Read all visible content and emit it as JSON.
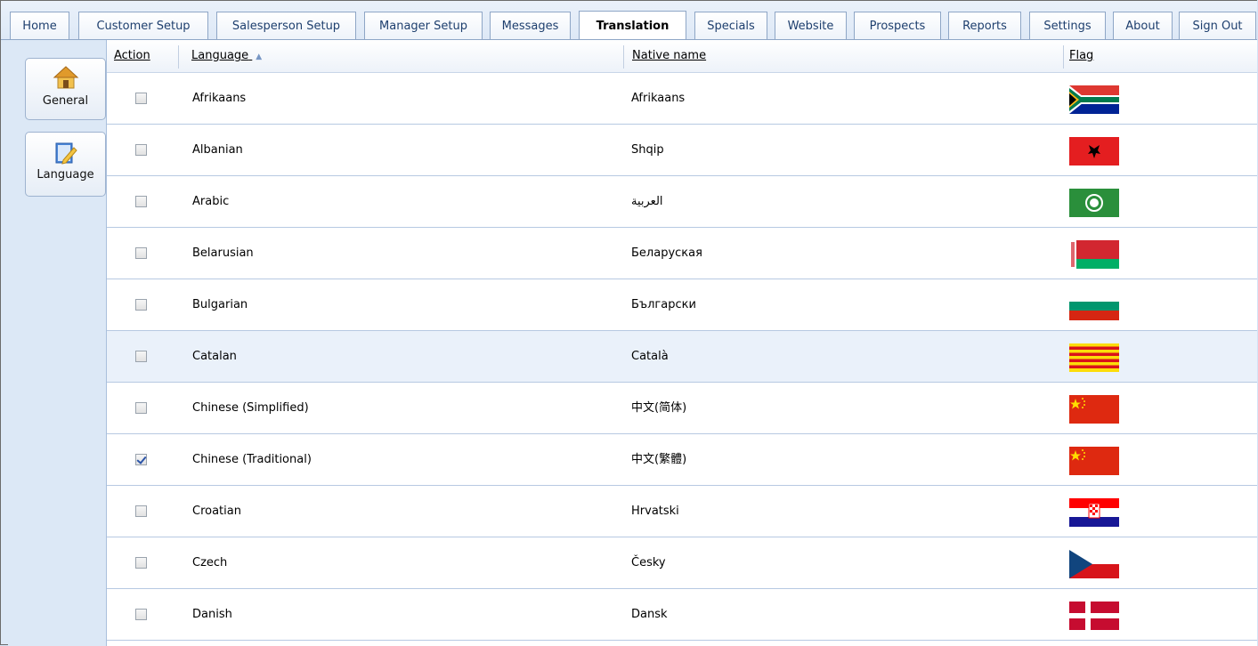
{
  "tabs": [
    {
      "label": "Home",
      "active": false
    },
    {
      "label": "Customer Setup",
      "active": false
    },
    {
      "label": "Salesperson Setup",
      "active": false
    },
    {
      "label": "Manager Setup",
      "active": false
    },
    {
      "label": "Messages",
      "active": false
    },
    {
      "label": "Translation",
      "active": true
    },
    {
      "label": "Specials",
      "active": false
    },
    {
      "label": "Website",
      "active": false
    },
    {
      "label": "Prospects",
      "active": false
    },
    {
      "label": "Reports",
      "active": false
    },
    {
      "label": "Settings",
      "active": false
    },
    {
      "label": "About",
      "active": false
    },
    {
      "label": "Sign Out",
      "active": false
    }
  ],
  "sidebar": {
    "items": [
      {
        "label": "General",
        "icon": "house-icon"
      },
      {
        "label": "Language",
        "icon": "edit-document-icon"
      }
    ]
  },
  "grid": {
    "columns": {
      "action": "Action",
      "language": "Language",
      "native": "Native name",
      "flag": "Flag"
    },
    "sort_indicator": "▲",
    "rows": [
      {
        "checked": false,
        "language": "Afrikaans",
        "native": "Afrikaans",
        "flag": "south-africa-flag-icon"
      },
      {
        "checked": false,
        "language": "Albanian",
        "native": "Shqip",
        "flag": "albania-flag-icon"
      },
      {
        "checked": false,
        "language": "Arabic",
        "native": "العربية",
        "flag": "arab-league-flag-icon"
      },
      {
        "checked": false,
        "language": "Belarusian",
        "native": "Беларуская",
        "flag": "belarus-flag-icon"
      },
      {
        "checked": false,
        "language": "Bulgarian",
        "native": "Български",
        "flag": "bulgaria-flag-icon"
      },
      {
        "checked": false,
        "language": "Catalan",
        "native": "Català",
        "flag": "catalonia-flag-icon",
        "highlighted": true
      },
      {
        "checked": false,
        "language": "Chinese (Simplified)",
        "native": "中文(简体)",
        "flag": "china-flag-icon"
      },
      {
        "checked": true,
        "language": "Chinese (Traditional)",
        "native": "中文(繁體)",
        "flag": "china-flag-icon"
      },
      {
        "checked": false,
        "language": "Croatian",
        "native": "Hrvatski",
        "flag": "croatia-flag-icon"
      },
      {
        "checked": false,
        "language": "Czech",
        "native": "Česky",
        "flag": "czech-flag-icon"
      },
      {
        "checked": false,
        "language": "Danish",
        "native": "Dansk",
        "flag": "denmark-flag-icon"
      }
    ]
  }
}
